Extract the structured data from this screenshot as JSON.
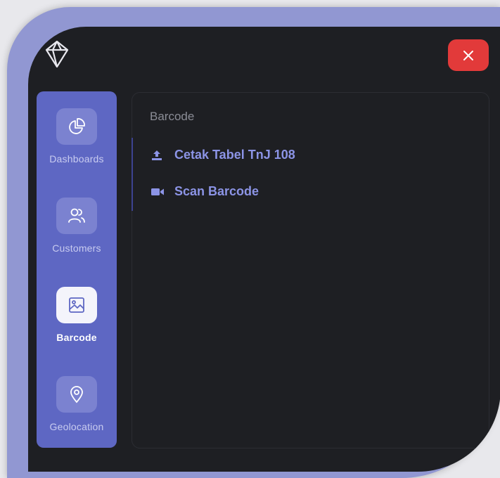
{
  "colors": {
    "frame": "#9197d2",
    "panel": "#1e1f23",
    "sidebar": "#5e67c3",
    "close": "#e23a3a",
    "menu_text": "#8c94e6"
  },
  "header": {
    "logo_icon": "gem-icon",
    "close_icon": "close-icon"
  },
  "sidebar": {
    "items": [
      {
        "label": "Dashboards",
        "icon": "pie-chart-icon",
        "active": false
      },
      {
        "label": "Customers",
        "icon": "users-icon",
        "active": false
      },
      {
        "label": "Barcode",
        "icon": "image-icon",
        "active": true
      },
      {
        "label": "Geolocation",
        "icon": "map-pin-icon",
        "active": false
      }
    ]
  },
  "content": {
    "title": "Barcode",
    "menu": [
      {
        "label": "Cetak Tabel TnJ 108",
        "icon": "upload-icon"
      },
      {
        "label": "Scan Barcode",
        "icon": "video-icon"
      }
    ]
  }
}
